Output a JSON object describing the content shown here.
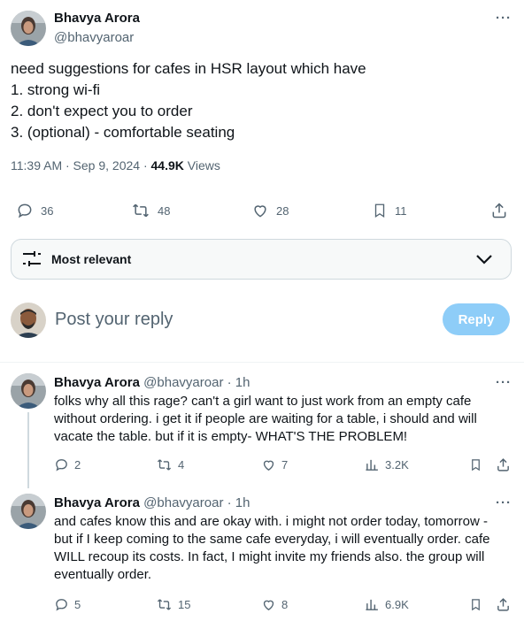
{
  "tweet": {
    "author_name": "Bhavya Arora",
    "author_handle": "@bhavyaroar",
    "lines": [
      "need suggestions for cafes in HSR layout which have",
      "1. strong wi-fi",
      "2. don't expect you to order",
      "3. (optional) - comfortable seating"
    ],
    "timestamp": "11:39 AM · Sep 9, 2024 · ",
    "views_count": "44.9K",
    "views_label": " Views",
    "stats": {
      "replies": "36",
      "reposts": "48",
      "likes": "28",
      "bookmarks": "11"
    }
  },
  "sort": {
    "label": "Most relevant"
  },
  "composer": {
    "placeholder": "Post your reply",
    "button_label": "Reply"
  },
  "replies": [
    {
      "author_name": "Bhavya Arora",
      "meta": "@bhavyaroar · 1h",
      "lines": [
        "folks why all this rage? can't a girl want to just work from an empty cafe",
        "without ordering. i get it if people are waiting for a table, i should and will",
        "vacate the table. but if it is empty- WHAT'S THE PROBLEM!"
      ],
      "stats": {
        "replies": "2",
        "reposts": "4",
        "likes": "7",
        "views": "3.2K"
      }
    },
    {
      "author_name": "Bhavya Arora",
      "meta": "@bhavyaroar · 1h",
      "lines": [
        "and cafes know this and are okay with. i might not order today, tomorrow -",
        "but if I keep coming to the same cafe everyday, i will eventually order. cafe",
        "WILL recoup its costs. In fact, I might invite my friends also. the group will",
        "eventually order."
      ],
      "stats": {
        "replies": "5",
        "reposts": "15",
        "likes": "8",
        "views": "6.9K"
      }
    }
  ],
  "colors": {
    "accent": "#1d9bf0",
    "reply_button": "#8ecdf8",
    "muted": "#536471",
    "text": "#0f1419"
  }
}
